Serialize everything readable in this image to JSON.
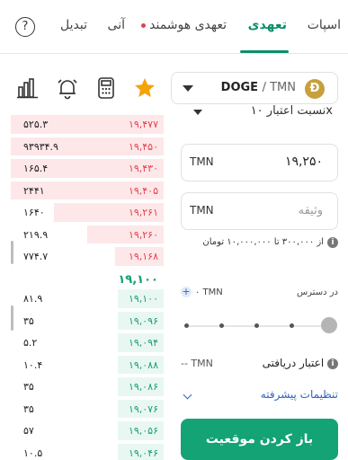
{
  "tabs": [
    {
      "label": "اسپات",
      "active": false
    },
    {
      "label": "تعهدی",
      "active": true
    },
    {
      "label": "تعهدی هوشمند",
      "active": false,
      "dot": true
    },
    {
      "label": "آنی",
      "active": false
    },
    {
      "label": "تبدیل",
      "active": false
    }
  ],
  "help_glyph": "?",
  "toolbar": {
    "icons": [
      "bar-chart-icon",
      "alarm-clock-icon",
      "calculator-icon",
      "star-icon"
    ],
    "star_color": "#f5a30b"
  },
  "pair": {
    "coin_glyph": "Ð",
    "base": "DOGE",
    "quote": "/ TMN",
    "coin_color": "#c6a03b"
  },
  "orderbook": {
    "asks": [
      {
        "qty": "۵۲۵.۳",
        "price": "۱۹,۴۷۷",
        "depth": 1.0
      },
      {
        "qty": "۹۳۹۳۴.۹",
        "price": "۱۹,۴۵۰",
        "depth": 1.0
      },
      {
        "qty": "۱۶۵.۴",
        "price": "۱۹,۴۳۰",
        "depth": 1.0
      },
      {
        "qty": "۲۴۴۱",
        "price": "۱۹,۴۰۵",
        "depth": 1.0
      },
      {
        "qty": "۱۶۴۰",
        "price": "۱۹,۲۶۱",
        "depth": 0.72
      },
      {
        "qty": "۲۱۹.۹",
        "price": "۱۹,۲۶۰",
        "depth": 0.5
      },
      {
        "qty": "۷۷۴.۷",
        "price": "۱۹,۱۶۸",
        "depth": 0.32
      }
    ],
    "mid_price": "۱۹,۱۰۰",
    "bids": [
      {
        "qty": "۸۱.۹",
        "price": "۱۹,۱۰۰",
        "depth": 0.3
      },
      {
        "qty": "۳۵",
        "price": "۱۹,۰۹۶",
        "depth": 0.3
      },
      {
        "qty": "۵.۲",
        "price": "۱۹,۰۹۴",
        "depth": 0.3
      },
      {
        "qty": "۱۰.۴",
        "price": "۱۹,۰۸۸",
        "depth": 0.3
      },
      {
        "qty": "۳۵",
        "price": "۱۹,۰۸۶",
        "depth": 0.3
      },
      {
        "qty": "۳۵",
        "price": "۱۹,۰۷۶",
        "depth": 0.3
      },
      {
        "qty": "۵۷",
        "price": "۱۹,۰۵۶",
        "depth": 0.3
      },
      {
        "qty": "۱۰.۵",
        "price": "۱۹,۰۴۶",
        "depth": 0.3
      }
    ]
  },
  "form": {
    "leverage_label": "نسبت اعتبار ۱۰x",
    "price_unit": "TMN",
    "price_value": "۱۹,۲۵۰",
    "collateral_unit": "TMN",
    "collateral_placeholder": "وثیقه",
    "range_text": "از ۳۰۰,۰۰۰ تا ۱۰,۰۰۰,۰۰۰ تومان",
    "available_label": "در دسترس",
    "available_value": "۰ TMN",
    "slider_value": 0,
    "credit_label": "اعتبار دریافتی",
    "credit_value": "-- TMN",
    "advanced_label": "تنظیمات پیشرفته",
    "submit_label": "باز کردن موقعیت"
  }
}
